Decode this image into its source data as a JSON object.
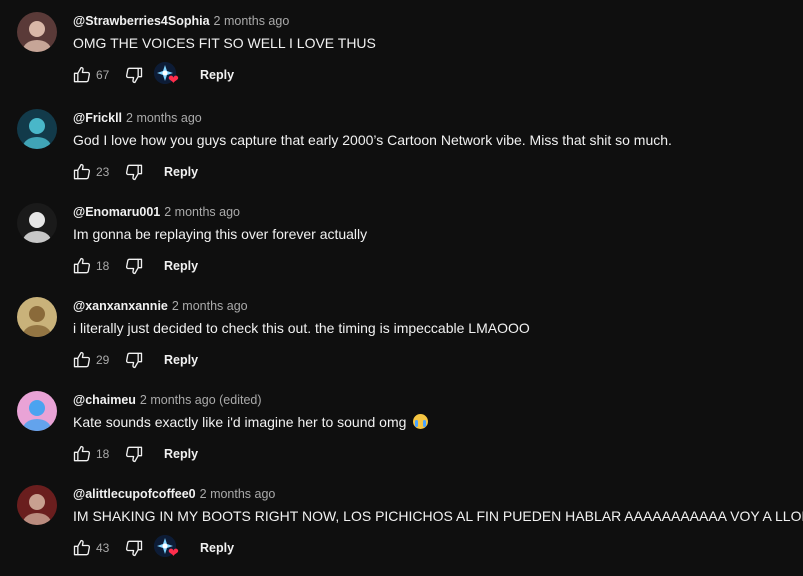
{
  "comments": [
    {
      "author": "@Strawberries4Sophia",
      "time": "2 months ago",
      "text": "OMG THE VOICES FIT SO WELL I LOVE THUS",
      "likes": "67",
      "creator_heart": true,
      "reply_label": "Reply",
      "avatar_colors": [
        "#5a3a38",
        "#d9b8a8"
      ]
    },
    {
      "author": "@Frickll",
      "time": "2 months ago",
      "text": "God I love how you guys capture that early 2000’s Cartoon Network vibe. Miss that shit so much.",
      "likes": "23",
      "creator_heart": false,
      "reply_label": "Reply",
      "avatar_colors": [
        "#123a4a",
        "#49b7c9"
      ]
    },
    {
      "author": "@Enomaru001",
      "time": "2 months ago",
      "text": "Im gonna be replaying this over forever actually",
      "likes": "18",
      "creator_heart": false,
      "reply_label": "Reply",
      "avatar_colors": [
        "#1a1a1a",
        "#e6e6e6"
      ]
    },
    {
      "author": "@xanxanxannie",
      "time": "2 months ago",
      "text": "i literally just decided to check this out. the timing is impeccable LMAOOO",
      "likes": "29",
      "creator_heart": false,
      "reply_label": "Reply",
      "avatar_colors": [
        "#c9b27a",
        "#8a6a3a"
      ]
    },
    {
      "author": "@chaimeu",
      "time": "2 months ago (edited)",
      "text": "Kate sounds exactly like i'd imagine her to sound omg",
      "emoji": "loudly-crying-face",
      "likes": "18",
      "creator_heart": false,
      "reply_label": "Reply",
      "avatar_colors": [
        "#e9a3d6",
        "#4ba3f0"
      ]
    },
    {
      "author": "@alittlecupofcoffee0",
      "time": "2 months ago",
      "text": "IM SHAKING IN MY BOOTS RIGHT NOW, LOS PICHICHOS AL FIN PUEDEN HABLAR AAAAAAAAAAA VOY A LLORAR",
      "likes": "43",
      "creator_heart": true,
      "reply_label": "Reply",
      "avatar_colors": [
        "#6a1e1e",
        "#c8a090"
      ]
    }
  ],
  "icons": {
    "like": "thumbs-up-icon",
    "dislike": "thumbs-down-icon",
    "creator_heart": "creator-heart-icon"
  }
}
